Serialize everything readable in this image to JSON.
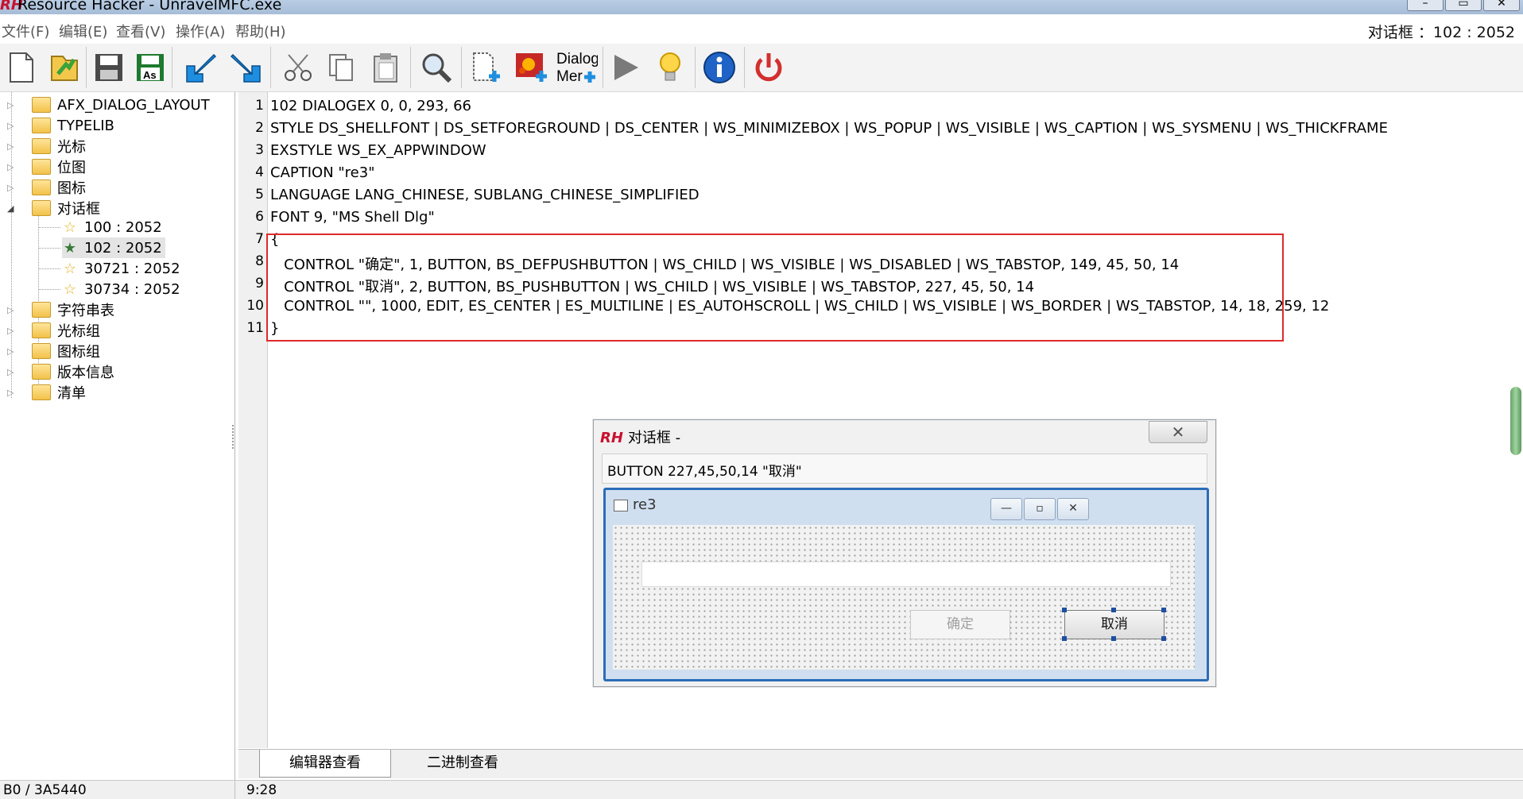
{
  "window": {
    "title": "Resource Hacker - UnravelMFC.exe",
    "logo": "RH",
    "controls": [
      "minimize",
      "maximize",
      "close"
    ]
  },
  "menu": [
    "文件(F)",
    "编辑(E)",
    "查看(V)",
    "操作(A)",
    "帮助(H)"
  ],
  "status_right": "对话框 ：102 : 2052",
  "toolbar": {
    "buttons": [
      {
        "icon": "new-file-icon"
      },
      {
        "icon": "open-folder-icon"
      },
      {
        "icon": "save-icon"
      },
      {
        "icon": "save-as-icon",
        "label": "As"
      },
      {
        "icon": "compile-arrow-icon"
      },
      {
        "icon": "back-arrow-icon"
      },
      {
        "icon": "cut-icon"
      },
      {
        "icon": "copy-icon"
      },
      {
        "icon": "paste-icon"
      },
      {
        "icon": "find-icon"
      },
      {
        "icon": "add-resource-icon"
      },
      {
        "icon": "add-image-icon"
      },
      {
        "icon": "dialog-merge-icon",
        "label1": "Dialog",
        "label2": "Mer"
      },
      {
        "icon": "play-icon"
      },
      {
        "icon": "lightbulb-icon"
      },
      {
        "icon": "info-icon"
      },
      {
        "icon": "power-icon"
      }
    ]
  },
  "tree": {
    "items": [
      {
        "label": "AFX_DIALOG_LAYOUT",
        "type": "folder"
      },
      {
        "label": "TYPELIB",
        "type": "folder"
      },
      {
        "label": "光标",
        "type": "folder"
      },
      {
        "label": "位图",
        "type": "folder"
      },
      {
        "label": "图标",
        "type": "folder"
      },
      {
        "label": "对话框",
        "type": "folder-open",
        "expanded": true
      },
      {
        "label": "100 : 2052",
        "type": "star"
      },
      {
        "label": "102 : 2052",
        "type": "star",
        "selected": true
      },
      {
        "label": "30721 : 2052",
        "type": "star"
      },
      {
        "label": "30734 : 2052",
        "type": "star"
      },
      {
        "label": "字符串表",
        "type": "folder"
      },
      {
        "label": "光标组",
        "type": "folder"
      },
      {
        "label": "图标组",
        "type": "folder"
      },
      {
        "label": "版本信息",
        "type": "folder"
      },
      {
        "label": "清单",
        "type": "folder"
      }
    ]
  },
  "editor": {
    "lines": [
      "102 DIALOGEX 0, 0, 293, 66",
      "STYLE DS_SHELLFONT | DS_SETFOREGROUND | DS_CENTER | WS_MINIMIZEBOX | WS_POPUP | WS_VISIBLE | WS_CAPTION | WS_SYSMENU | WS_THICKFRAME",
      "EXSTYLE WS_EX_APPWINDOW",
      "CAPTION \"re3\"",
      "LANGUAGE LANG_CHINESE, SUBLANG_CHINESE_SIMPLIFIED",
      "FONT 9, \"MS Shell Dlg\"",
      "{",
      "   CONTROL \"确定\", 1, BUTTON, BS_DEFPUSHBUTTON | WS_CHILD | WS_VISIBLE | WS_DISABLED | WS_TABSTOP, 149, 45, 50, 14",
      "   CONTROL \"取消\", 2, BUTTON, BS_PUSHBUTTON | WS_CHILD | WS_VISIBLE | WS_TABSTOP, 227, 45, 50, 14",
      "   CONTROL \"\", 1000, EDIT, ES_CENTER | ES_MULTILINE | ES_AUTOHSCROLL | WS_CHILD | WS_VISIBLE | WS_BORDER | WS_TABSTOP, 14, 18, 259, 12",
      "}"
    ],
    "highlight_color": "#e02a2a"
  },
  "preview": {
    "title": "对话框 -",
    "logo": "RH",
    "close_glyph": "✕",
    "info": "BUTTON  227,45,50,14  \"取消\"",
    "dialog": {
      "caption": "re3",
      "ok_label": "确定",
      "cancel_label": "取消"
    }
  },
  "tabs": [
    "编辑器查看",
    "二进制查看"
  ],
  "statusbar": {
    "offset": "B0 / 3A5440",
    "cursor": "9:28"
  }
}
